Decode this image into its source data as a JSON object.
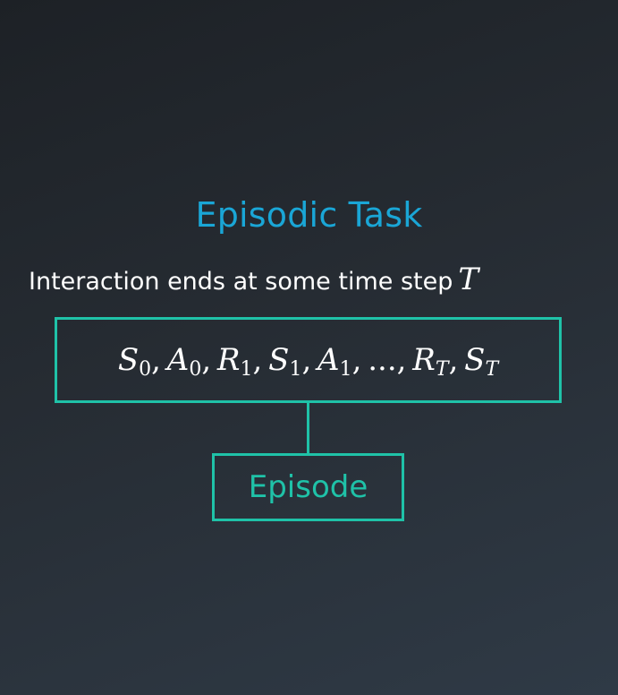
{
  "title": "Episodic Task",
  "subtitle": {
    "text": "Interaction ends at some time step",
    "math_symbol": "T"
  },
  "sequence": {
    "terms": [
      {
        "sym": "S",
        "sub": "0",
        "sub_italic": false,
        "sep": ","
      },
      {
        "sym": "A",
        "sub": "0",
        "sub_italic": false,
        "sep": ","
      },
      {
        "sym": "R",
        "sub": "1",
        "sub_italic": false,
        "sep": ","
      },
      {
        "sym": "S",
        "sub": "1",
        "sub_italic": false,
        "sep": ","
      },
      {
        "sym": "A",
        "sub": "1",
        "sub_italic": false,
        "sep": ","
      },
      {
        "sym": "...",
        "sub": "",
        "sub_italic": false,
        "sep": ","
      },
      {
        "sym": "R",
        "sub": "T",
        "sub_italic": true,
        "sep": ","
      },
      {
        "sym": "S",
        "sub": "T",
        "sub_italic": true,
        "sep": ""
      }
    ]
  },
  "episode_label": "Episode",
  "colors": {
    "title": "#1aa6d6",
    "accent": "#1fc2a8",
    "text": "#ffffff",
    "background": "#262c33"
  }
}
